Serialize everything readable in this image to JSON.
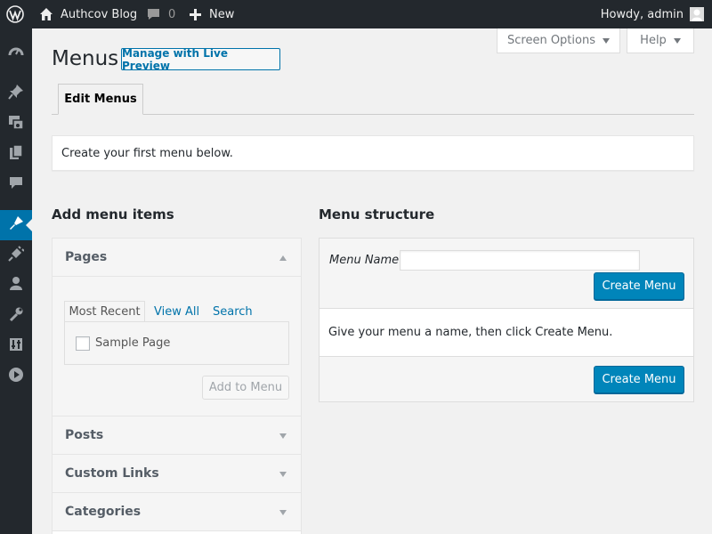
{
  "adminbar": {
    "site_name": "Authcov Blog",
    "comments_count": "0",
    "new_label": "New",
    "howdy": "Howdy, admin"
  },
  "sidebar": {
    "items": [
      {
        "icon": "dashboard-icon"
      },
      {
        "icon": "pin-icon"
      },
      {
        "icon": "media-icon"
      },
      {
        "icon": "pages-icon"
      },
      {
        "icon": "comments-icon"
      },
      {
        "icon": "appearance-icon",
        "current": true
      },
      {
        "icon": "plugins-icon"
      },
      {
        "icon": "users-icon"
      },
      {
        "icon": "tools-icon"
      },
      {
        "icon": "settings-icon"
      },
      {
        "icon": "media-play-icon"
      }
    ]
  },
  "header": {
    "title": "Menus",
    "live_preview_label": "Manage with Live Preview",
    "screen_options_label": "Screen Options",
    "help_label": "Help"
  },
  "tabs": [
    {
      "label": "Edit Menus"
    }
  ],
  "notice": "Create your first menu below.",
  "add_items": {
    "heading": "Add menu items",
    "sections": [
      {
        "label": "Pages",
        "expanded": true
      },
      {
        "label": "Posts",
        "expanded": false
      },
      {
        "label": "Custom Links",
        "expanded": false
      },
      {
        "label": "Categories",
        "expanded": false
      }
    ],
    "pages_tabs": [
      "Most Recent",
      "View All",
      "Search"
    ],
    "pages": [
      {
        "title": "Sample Page",
        "checked": false
      }
    ],
    "add_button": "Add to Menu"
  },
  "structure": {
    "heading": "Menu structure",
    "menu_name_label": "Menu Name",
    "menu_name_value": "",
    "instructions": "Give your menu a name, then click Create Menu.",
    "create_button": "Create Menu"
  },
  "colors": {
    "admin_bar": "#23282d",
    "accent": "#0073aa",
    "primary_button": "#0085ba"
  }
}
